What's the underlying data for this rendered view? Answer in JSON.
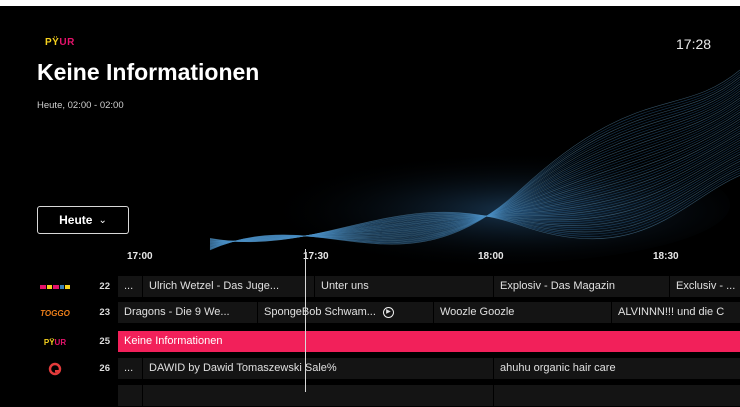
{
  "header": {
    "brand": "PŸUR",
    "clock": "17:28",
    "title": "Keine Informationen",
    "subtitle": "Heute, 02:00 - 02:00",
    "day_button": "Heute"
  },
  "timeline": {
    "ticks": [
      "17:00",
      "17:30",
      "18:00",
      "18:30"
    ]
  },
  "channels": [
    {
      "number": "22",
      "logo": "channel-logo",
      "cells": [
        "...",
        "Ulrich Wetzel - Das Juge...",
        "Unter uns",
        "Explosiv - Das Magazin",
        "Exclusiv - ..."
      ]
    },
    {
      "number": "23",
      "logo": "toggo-plus-logo",
      "cells": [
        "Dragons - Die 9 We...",
        "SpongeBob Schwam...",
        "Woozle Goozle",
        "ALVINNN!!! und die C"
      ]
    },
    {
      "number": "25",
      "logo": "pyur-logo",
      "cells": [
        "Keine Informationen"
      ]
    },
    {
      "number": "26",
      "logo": "qvc-logo",
      "cells": [
        "...",
        "DAWID by Dawid Tomaszewski Sale%",
        "ahuhu organic hair care"
      ]
    }
  ],
  "colors": {
    "accent": "#f2205a",
    "cell": "#141414",
    "wave": "#3a7fb8"
  },
  "icons": [
    "chevron-down-icon",
    "play-circle-icon"
  ]
}
